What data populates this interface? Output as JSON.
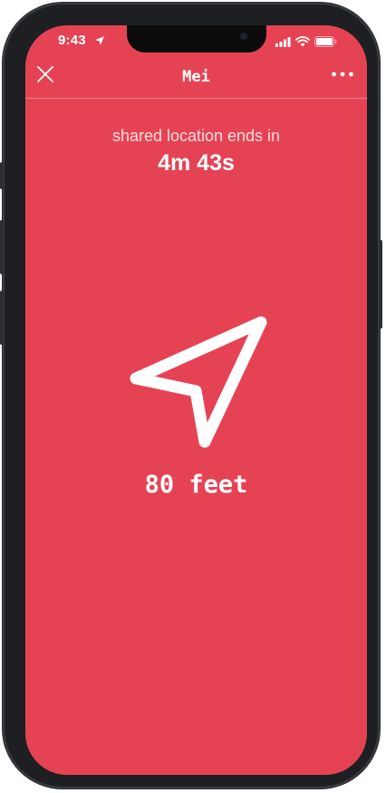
{
  "status_bar": {
    "time": "9:43",
    "icons": [
      "location-arrow-icon",
      "signal-icon",
      "wifi-icon",
      "battery-icon"
    ]
  },
  "nav": {
    "title": "Mei",
    "close_icon": "close-icon",
    "more_icon": "more-horizontal-icon"
  },
  "location_share": {
    "label": "shared location ends in",
    "remaining": "4m 43s"
  },
  "direction": {
    "icon": "navigation-arrow-icon",
    "distance": "80 feet"
  },
  "colors": {
    "background": "#e54354",
    "foreground": "#ffffff"
  }
}
